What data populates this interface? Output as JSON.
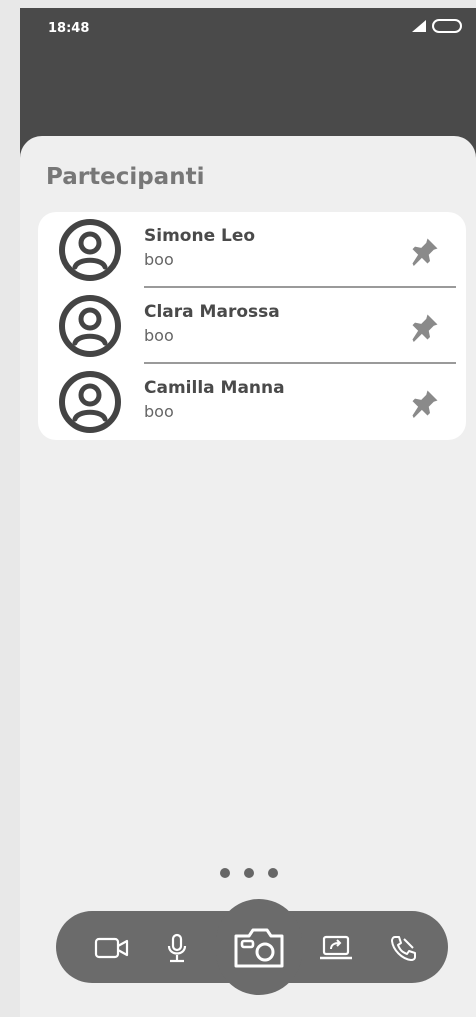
{
  "status_bar": {
    "time": "18:48"
  },
  "page": {
    "title": "Partecipanti"
  },
  "participants": [
    {
      "name": "Simone Leo",
      "subtitle": "boo"
    },
    {
      "name": "Clara Marossa",
      "subtitle": "boo"
    },
    {
      "name": "Camilla Manna",
      "subtitle": "boo"
    }
  ],
  "pager": {
    "dots": 3
  },
  "toolbar": {
    "icons": [
      "video-camera-icon",
      "microphone-icon",
      "camera-icon",
      "screen-share-icon",
      "end-call-icon"
    ]
  },
  "colors": {
    "header": "#4a4a4a",
    "background": "#efefef",
    "toolbar": "#6b6b6b",
    "icon_dark": "#444444",
    "pin": "#8a8a8a"
  }
}
